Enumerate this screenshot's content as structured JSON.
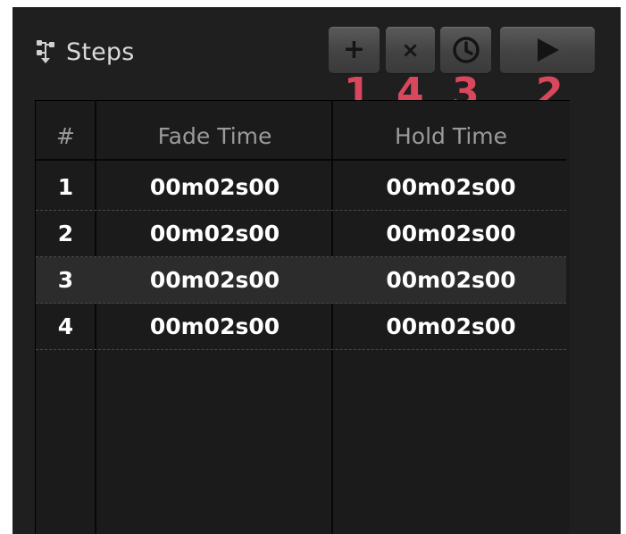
{
  "panel": {
    "title": "Steps",
    "icon": "steps-flow-icon"
  },
  "toolbar": {
    "add_glyph": "+",
    "remove_glyph": "×",
    "timing_icon": "clock-icon",
    "play_icon": "play-icon"
  },
  "annotations": [
    "1",
    "4",
    "3",
    "2"
  ],
  "table": {
    "headers": [
      "#",
      "Fade Time",
      "Hold Time"
    ],
    "rows": [
      {
        "num": "1",
        "fade": "00m02s00",
        "hold": "00m02s00"
      },
      {
        "num": "2",
        "fade": "00m02s00",
        "hold": "00m02s00"
      },
      {
        "num": "3",
        "fade": "00m02s00",
        "hold": "00m02s00"
      },
      {
        "num": "4",
        "fade": "00m02s00",
        "hold": "00m02s00"
      }
    ],
    "selected_row": 3
  },
  "colors": {
    "panel_bg": "#1f1f1f",
    "annotation": "#d8475c",
    "button": "#4a4a4a"
  }
}
